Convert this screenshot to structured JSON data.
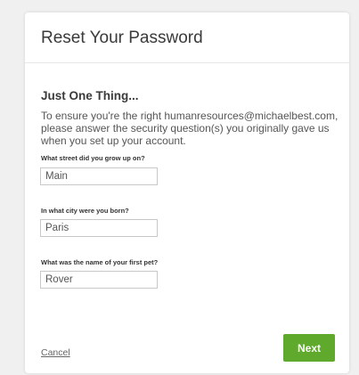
{
  "dialog": {
    "title": "Reset Your Password",
    "subtitle": "Just One Thing...",
    "intro": "To ensure you're the right humanresources@michaelbest.com, please answer the security question(s) you originally gave us when you set up your account."
  },
  "questions": [
    {
      "label": "What street did you grow up on?",
      "value": "Main"
    },
    {
      "label": "In what city were you born?",
      "value": "Paris"
    },
    {
      "label": "What was the name of your first pet?",
      "value": "Rover"
    }
  ],
  "actions": {
    "cancel_label": "Cancel",
    "next_label": "Next"
  },
  "colors": {
    "next_button": "#5fa92d",
    "background": "#f0f0f0"
  }
}
